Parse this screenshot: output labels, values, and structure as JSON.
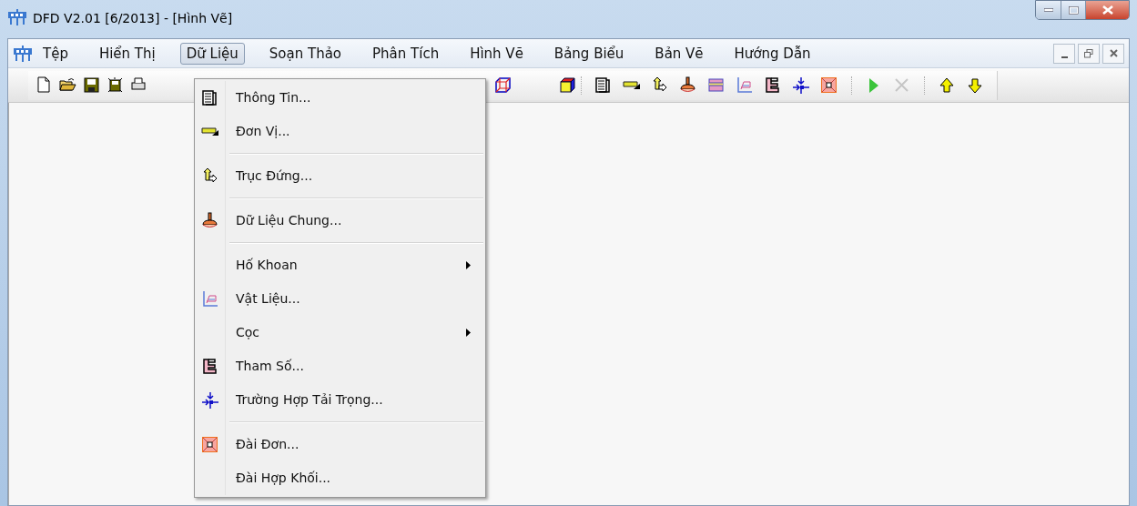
{
  "window": {
    "title": "DFD V2.01 [6/2013] - [Hình Vẽ]"
  },
  "menu": [
    {
      "label": "Tệp",
      "selected": false
    },
    {
      "label": "Hiển Thị",
      "selected": false
    },
    {
      "label": "Dữ Liệu",
      "selected": true
    },
    {
      "label": "Soạn Thảo",
      "selected": false
    },
    {
      "label": "Phân Tích",
      "selected": false
    },
    {
      "label": "Hình Vẽ",
      "selected": false
    },
    {
      "label": "Bảng Biểu",
      "selected": false
    },
    {
      "label": "Bản Vẽ",
      "selected": false
    },
    {
      "label": "Hướng Dẫn",
      "selected": false
    }
  ],
  "toolbar": [
    [
      {
        "disabled": false
      },
      {
        "disabled": false
      },
      {
        "disabled": false
      },
      {
        "disabled": false
      },
      {
        "disabled": false
      }
    ],
    [
      {
        "disabled": false
      },
      {
        "disabled": false
      }
    ],
    [
      {
        "disabled": false
      },
      {
        "disabled": false
      },
      {
        "disabled": false
      },
      {
        "disabled": false
      },
      {
        "disabled": false
      },
      {
        "disabled": false
      },
      {
        "disabled": false
      },
      {
        "disabled": false
      },
      {
        "disabled": false
      }
    ],
    [
      {
        "disabled": false
      },
      {
        "disabled": true
      }
    ],
    [
      {
        "disabled": false
      },
      {
        "disabled": false
      }
    ]
  ],
  "dropdown": [
    {
      "kind": "item",
      "label": "Thông Tin..."
    },
    {
      "kind": "item",
      "label": "Đơn Vị..."
    },
    {
      "kind": "separator"
    },
    {
      "kind": "item",
      "label": "Trục Đứng..."
    },
    {
      "kind": "separator"
    },
    {
      "kind": "item",
      "label": "Dữ Liệu Chung..."
    },
    {
      "kind": "separator"
    },
    {
      "kind": "submenu",
      "label": "Hố Khoan"
    },
    {
      "kind": "item",
      "label": "Vật Liệu..."
    },
    {
      "kind": "submenu",
      "label": "Cọc"
    },
    {
      "kind": "item",
      "label": "Tham Số..."
    },
    {
      "kind": "item",
      "label": "Trường Hợp Tải Trọng..."
    },
    {
      "kind": "separator"
    },
    {
      "kind": "item",
      "label": "Đài Đơn..."
    },
    {
      "kind": "item",
      "label": "Đài Hợp Khối..."
    }
  ]
}
